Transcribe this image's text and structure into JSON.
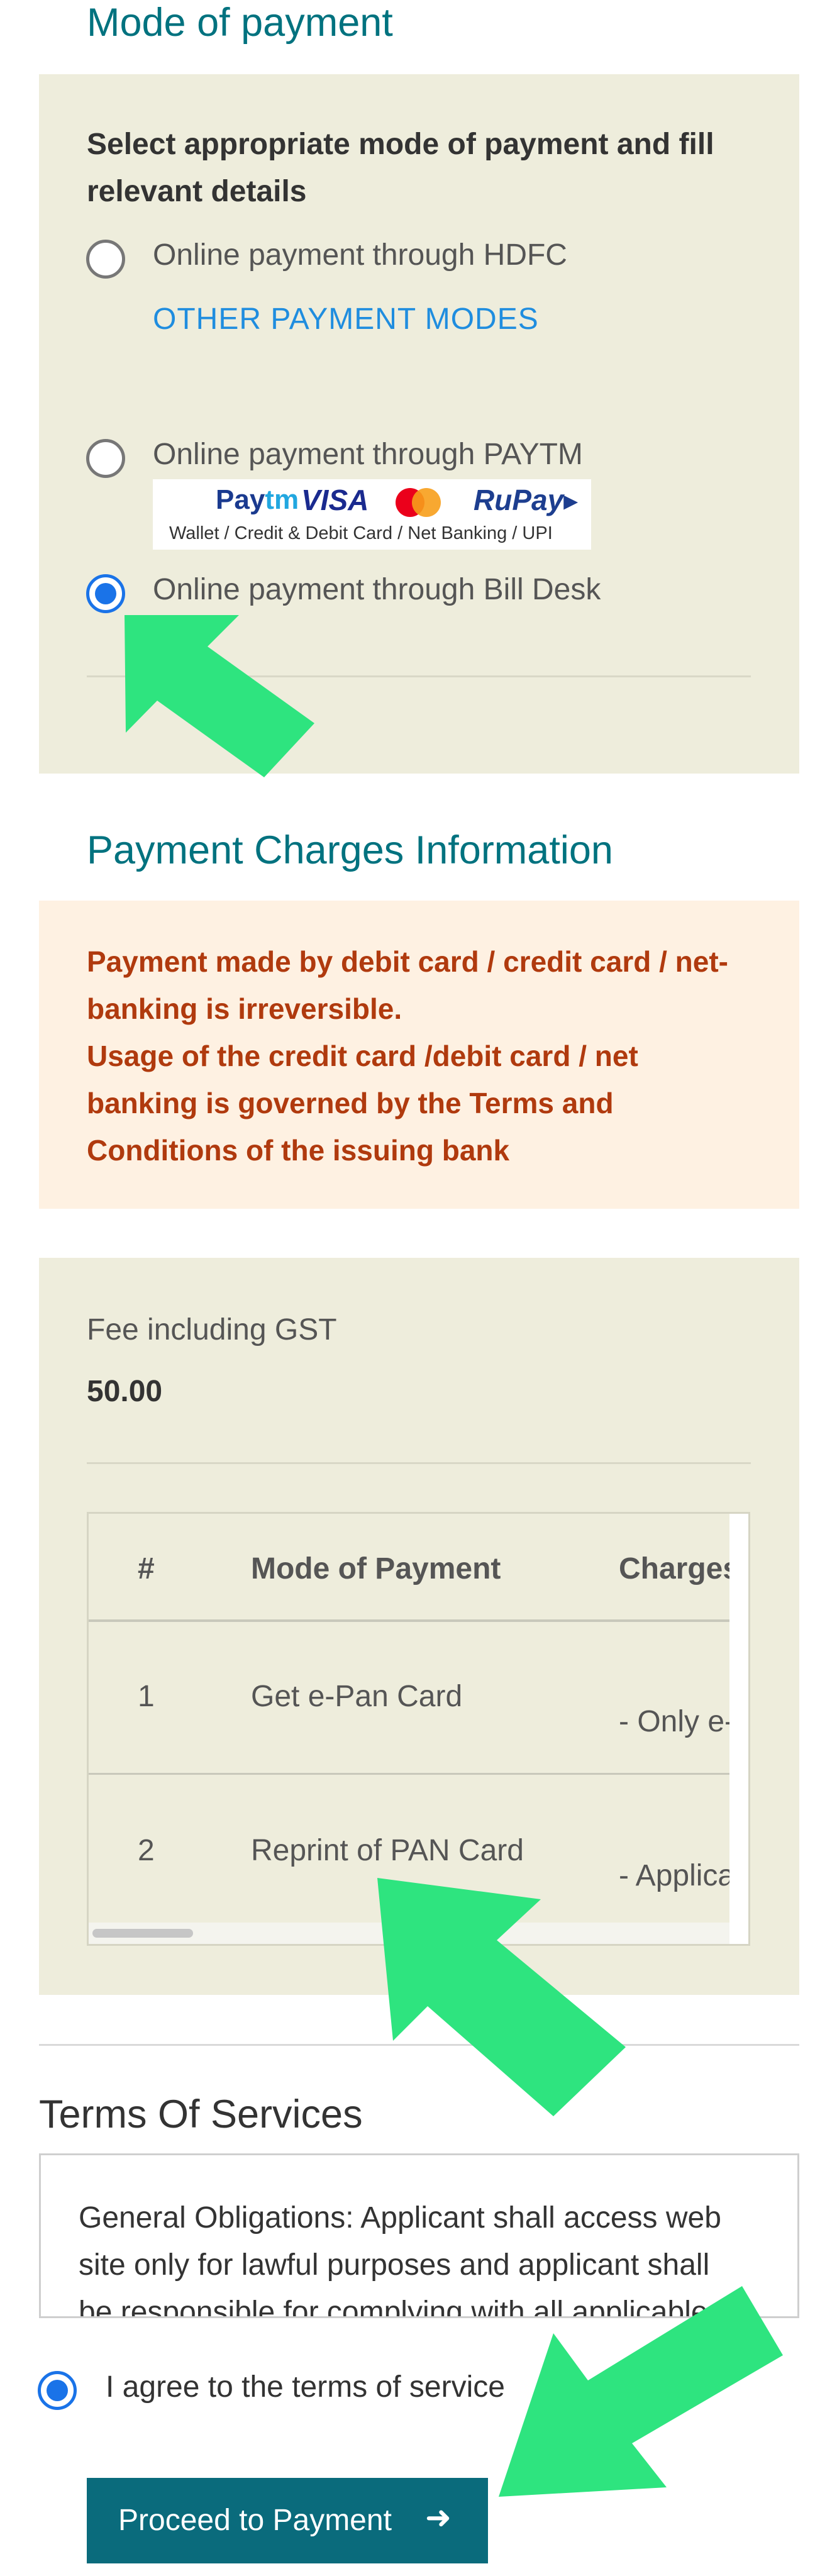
{
  "payment_mode": {
    "heading": "Mode of payment",
    "instruction_line1": "Select appropriate mode of payment and fill",
    "instruction_line2": "relevant details",
    "options": [
      {
        "label": "Online payment through HDFC",
        "selected": false
      },
      {
        "label": "Online payment through PAYTM",
        "selected": false
      },
      {
        "label": "Online payment through Bill Desk",
        "selected": true
      }
    ],
    "other_modes_link": "OTHER PAYMENT MODES",
    "paytm_logos": {
      "paytm_a": "Pay",
      "paytm_b": "tm",
      "visa": "VISA",
      "rupay": "RuPay▸",
      "subtitle": "Wallet / Credit & Debit Card / Net Banking / UPI"
    }
  },
  "charges": {
    "heading": "Payment Charges Information",
    "notice_lines": [
      "Payment made by debit card / credit card / net-",
      "banking is irreversible.",
      "Usage of the credit card /debit card / net",
      "banking is governed by the Terms and",
      "Conditions of the issuing bank"
    ],
    "fee_label": "Fee including GST",
    "fee_value": "50.00",
    "table": {
      "headers": [
        "#",
        "Mode of Payment",
        "Charges"
      ],
      "rows": [
        {
          "num": "1",
          "mode": "Get e-Pan Card",
          "charges": "- Only e-"
        },
        {
          "num": "2",
          "mode": "Reprint of PAN Card",
          "charges": "- Applica"
        }
      ]
    }
  },
  "terms": {
    "heading": "Terms Of Services",
    "text": "General Obligations: Applicant shall access web site only for lawful purposes and applicant shall be responsible for complying with all applicable",
    "agree_label": "I agree to the terms of service",
    "agreed": true
  },
  "proceed_button": {
    "label": "Proceed to Payment",
    "icon": "arrow-right-icon"
  },
  "colors": {
    "accent": "#00727f",
    "panel": "#eeeddc",
    "notice_bg": "#fef1e2",
    "notice_text": "#b03a0e",
    "radio_selected": "#1a73e8",
    "button": "#0a6b7c",
    "annotation_arrow": "#2ee47f"
  }
}
